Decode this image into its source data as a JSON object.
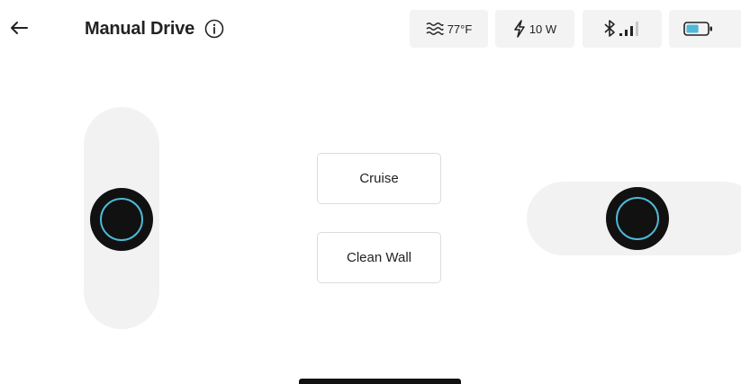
{
  "header": {
    "title": "Manual Drive",
    "back_icon": "arrow-left-icon",
    "info_icon": "info-circle-icon"
  },
  "status": {
    "temperature": "77°F",
    "temperature_icon": "water-waves-icon",
    "power": "10 W",
    "power_icon": "lightning-bolt-icon",
    "signal_icon": "bluetooth-signal-icon",
    "battery_icon": "battery-icon",
    "battery_level": 0.6,
    "accent_color": "#4fb9d6"
  },
  "controls": {
    "cruise_label": "Cruise",
    "clean_wall_label": "Clean Wall"
  }
}
